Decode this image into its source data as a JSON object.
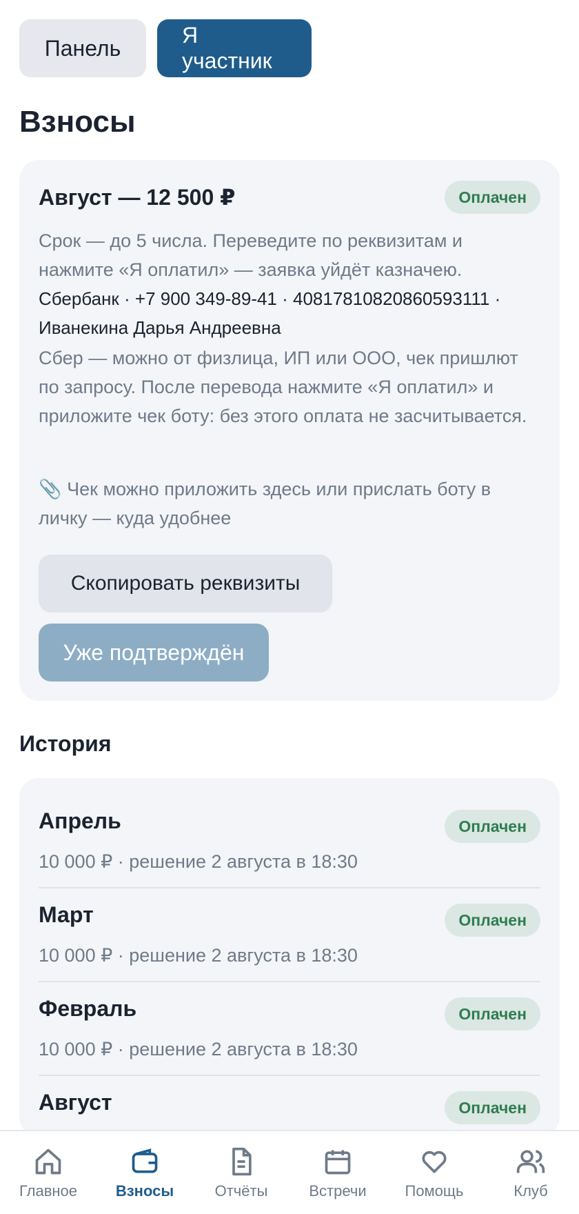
{
  "mode_switch": {
    "panel_label": "Панель",
    "member_label": "Я участник"
  },
  "page_title": "Взносы",
  "current": {
    "title": "Август — 12 500 ₽",
    "status": "Оплачен",
    "instructions": "Срок — до 5 числа. Переведите по реквизитам и нажмите «Я оплатил» — заявка уйдёт казначею.",
    "requisites_line1": "Сбербанк · +7 900 349-89-41 · 40817810820860593111 ·",
    "requisites_line2": "Иванекина Дарья Андреевна",
    "bank_note": "Сбер — можно от физлица, ИП или ООО, чек пришлют по запросу. После перевода нажмите «Я оплатил» и приложите чек боту: без этого оплата не засчитывается.",
    "receipt_note": "📎 Чек можно приложить здесь или прислать боту в личку — куда удобнее",
    "copy_button": "Скопировать реквизиты",
    "confirmed_button": "Уже подтверждён"
  },
  "history": {
    "title": "История",
    "rows": [
      {
        "month": "Апрель",
        "meta": "10 000 ₽ · решение 2 августа в 18:30",
        "status": "Оплачен"
      },
      {
        "month": "Март",
        "meta": "10 000 ₽ · решение 2 августа в 18:30",
        "status": "Оплачен"
      },
      {
        "month": "Февраль",
        "meta": "10 000 ₽ · решение 2 августа в 18:30",
        "status": "Оплачен"
      },
      {
        "month": "Август",
        "meta": "",
        "status": "Оплачен"
      }
    ]
  },
  "nav": {
    "items": [
      {
        "label": "Главное",
        "icon": "home-icon"
      },
      {
        "label": "Взносы",
        "icon": "wallet-icon"
      },
      {
        "label": "Отчёты",
        "icon": "document-icon"
      },
      {
        "label": "Встречи",
        "icon": "calendar-icon"
      },
      {
        "label": "Помощь",
        "icon": "heart-icon"
      },
      {
        "label": "Клуб",
        "icon": "users-icon"
      }
    ],
    "active_index": 1
  },
  "colors": {
    "accent": "#1f5c8b",
    "badge_bg": "#dbe7e2",
    "badge_text": "#2e7d4f",
    "card_bg": "#f3f5f8",
    "muted_text": "#6e7a8a"
  }
}
